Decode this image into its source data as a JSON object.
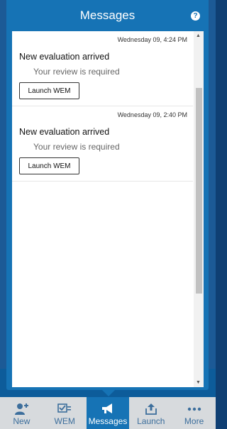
{
  "popup": {
    "title": "Messages",
    "help_glyph": "?"
  },
  "messages": [
    {
      "time": "Wednesday 09, 4:24 PM",
      "title": "New evaluation arrived",
      "subtitle": "Your review is required",
      "action_label": "Launch WEM"
    },
    {
      "time": "Wednesday 09, 2:40 PM",
      "title": "New evaluation arrived",
      "subtitle": "Your review is required",
      "action_label": "Launch WEM"
    }
  ],
  "nav": {
    "items": [
      {
        "label": "New",
        "icon": "add-user-icon",
        "active": false
      },
      {
        "label": "WEM",
        "icon": "checklist-icon",
        "active": false
      },
      {
        "label": "Messages",
        "icon": "megaphone-icon",
        "active": true
      },
      {
        "label": "Launch",
        "icon": "share-upload-icon",
        "active": false
      },
      {
        "label": "More",
        "icon": "more-dots-icon",
        "active": false
      }
    ]
  },
  "colors": {
    "accent": "#1673b5",
    "nav_background": "#d7dadd",
    "nav_text": "#3c6e9c"
  }
}
